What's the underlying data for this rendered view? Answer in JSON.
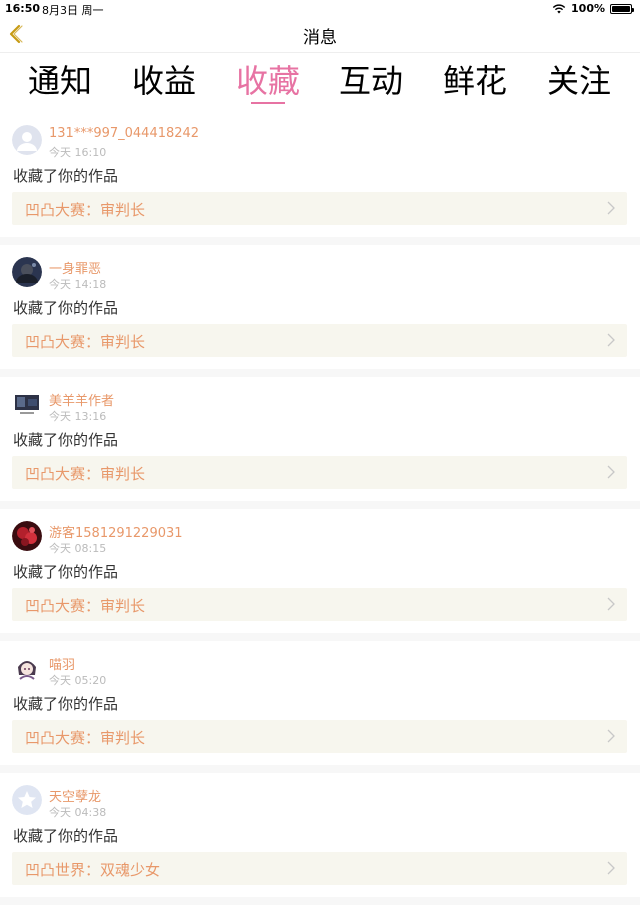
{
  "statusbar": {
    "time": "16:50",
    "date": "8月3日 周一",
    "battery": "100%"
  },
  "nav": {
    "title": "消息"
  },
  "tabs": [
    {
      "label": "通知",
      "active": false
    },
    {
      "label": "收益",
      "active": false
    },
    {
      "label": "收藏",
      "active": true
    },
    {
      "label": "互动",
      "active": false
    },
    {
      "label": "鲜花",
      "active": false
    },
    {
      "label": "关注",
      "active": false
    }
  ],
  "items": [
    {
      "username": "131***997_044418242",
      "time": "今天 16:10",
      "action": "收藏了你的作品",
      "work": "凹凸大赛：审判长",
      "avatar": "default"
    },
    {
      "username": "一身罪恶",
      "time": "今天 14:18",
      "action": "收藏了你的作品",
      "work": "凹凸大赛：审判长",
      "avatar": "dark"
    },
    {
      "username": "美羊羊作者",
      "time": "今天 13:16",
      "action": "收藏了你的作品",
      "work": "凹凸大赛：审判长",
      "avatar": "dark-screen"
    },
    {
      "username": "游客1581291229031",
      "time": "今天 08:15",
      "action": "收藏了你的作品",
      "work": "凹凸大赛：审判长",
      "avatar": "red-flower"
    },
    {
      "username": "喵羽",
      "time": "今天 05:20",
      "action": "收藏了你的作品",
      "work": "凹凸大赛：审判长",
      "avatar": "anime"
    },
    {
      "username": "天空孽龙",
      "time": "今天 04:38",
      "action": "收藏了你的作品",
      "work": "凹凸世界：双魂少女",
      "avatar": "star"
    }
  ],
  "colors": {
    "accent": "#e773a3",
    "username": "#e8986a",
    "card_bg": "#f7f6ee"
  }
}
